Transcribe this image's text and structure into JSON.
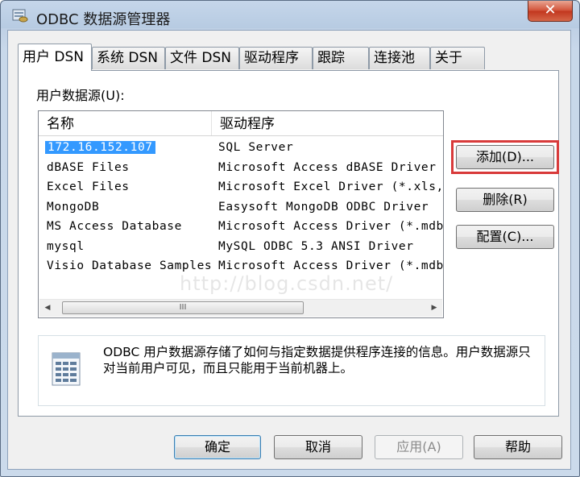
{
  "window": {
    "title": "ODBC 数据源管理器",
    "close_label": "✕"
  },
  "tabs": [
    {
      "label": "用户 DSN",
      "active": true
    },
    {
      "label": "系统 DSN",
      "active": false
    },
    {
      "label": "文件 DSN",
      "active": false
    },
    {
      "label": "驱动程序",
      "active": false
    },
    {
      "label": "跟踪",
      "active": false
    },
    {
      "label": "连接池",
      "active": false
    },
    {
      "label": "关于",
      "active": false
    }
  ],
  "panel": {
    "label": "用户数据源(U):",
    "columns": [
      "名称",
      "驱动程序"
    ],
    "rows": [
      {
        "name": "172.16.152.107",
        "driver": "SQL Server",
        "selected": true
      },
      {
        "name": "dBASE Files",
        "driver": "Microsoft Access dBASE Driver"
      },
      {
        "name": "Excel Files",
        "driver": "Microsoft Excel Driver (*.xls,"
      },
      {
        "name": "MongoDB",
        "driver": "Easysoft MongoDB ODBC Driver"
      },
      {
        "name": "MS Access Database",
        "driver": "Microsoft Access Driver (*.mdb"
      },
      {
        "name": "mysql",
        "driver": "MySQL ODBC 5.3 ANSI Driver"
      },
      {
        "name": "Visio Database Samples",
        "driver": "Microsoft Access Driver (*.mdb"
      }
    ],
    "scroll_left": "◀",
    "scroll_right": "▶",
    "scroll_grip": "III",
    "buttons": {
      "add": "添加(D)...",
      "remove": "删除(R)",
      "configure": "配置(C)..."
    },
    "info": "ODBC 用户数据源存储了如何与指定数据提供程序连接的信息。用户数据源只对当前用户可见，而且只能用于当前机器上。",
    "watermark": "http://blog.csdn.net/"
  },
  "footer": {
    "ok": "确定",
    "cancel": "取消",
    "apply": "应用(A)",
    "help": "帮助"
  },
  "colors": {
    "selection": "#3399ff",
    "highlight_box": "#d83a3a",
    "close_button": "#c2371f"
  }
}
